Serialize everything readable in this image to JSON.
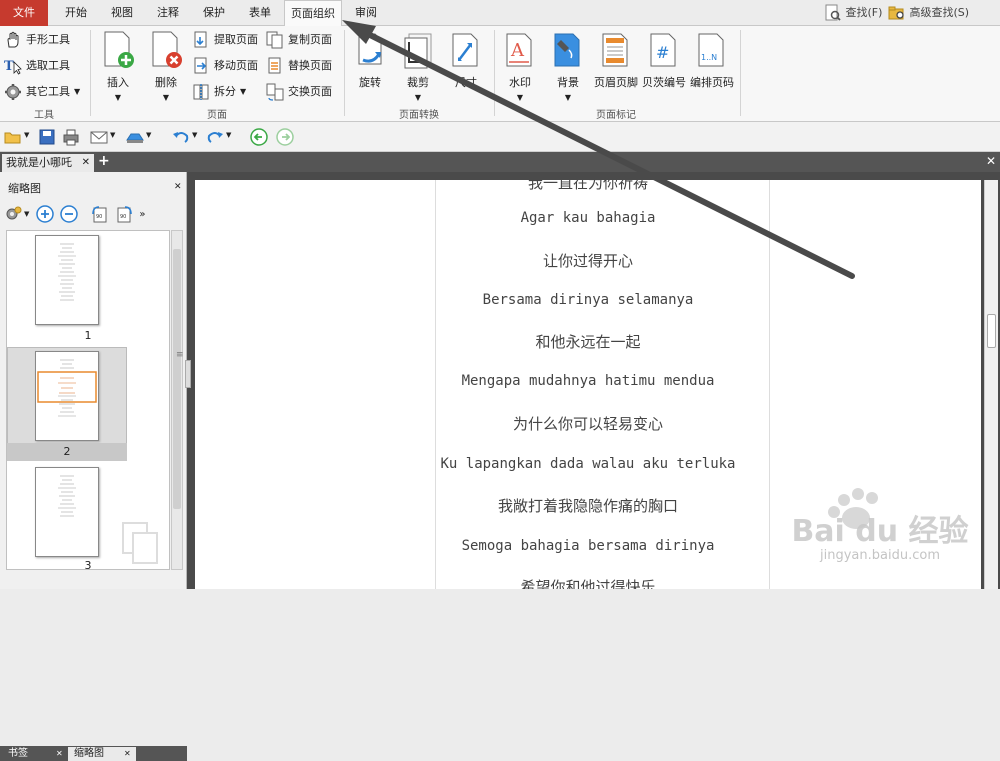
{
  "menubar": {
    "file": "文件",
    "tabs": [
      "开始",
      "视图",
      "注释",
      "保护",
      "表单",
      "页面组织",
      "审阅"
    ],
    "active_tab": "页面组织",
    "find": "查找(F)",
    "advanced_find": "高级查找(S)"
  },
  "ribbon": {
    "tools": {
      "hand": "手形工具",
      "select": "选取工具",
      "other": "其它工具",
      "label": "工具"
    },
    "page_group": {
      "insert": "插入",
      "delete": "删除",
      "extract": "提取页面",
      "move": "移动页面",
      "split": "拆分",
      "copy": "复制页面",
      "replace": "替换页面",
      "swap": "交换页面",
      "label": "页面"
    },
    "transform_group": {
      "rotate": "旋转",
      "crop": "裁剪",
      "size": "尺寸",
      "label": "页面转换"
    },
    "mark_group": {
      "watermark": "水印",
      "background": "背景",
      "header_footer": "页眉页脚",
      "bates": "贝茨编号",
      "page_number": "编排页码",
      "label": "页面标记"
    }
  },
  "doc_tab": {
    "title": "我就是小哪吒"
  },
  "left_panel": {
    "title": "缩略图",
    "thumbs": [
      "1",
      "2",
      "3"
    ],
    "bottom_tabs": [
      "书签",
      "缩略图"
    ]
  },
  "document": {
    "lines": [
      "我一直在为你祈祷",
      "Agar kau bahagia",
      "让你过得开心",
      "Bersama dirinya selamanya",
      "和他永远在一起",
      "Mengapa mudahnya hatimu mendua",
      "为什么你可以轻易变心",
      "Ku lapangkan dada walau aku terluka",
      "我敞打着我隐隐作痛的胸口",
      "Semoga bahagia bersama dirinya",
      "希望你和他过得快乐"
    ]
  },
  "watermark": {
    "brand": "Bai du 经验",
    "url": "jingyan.baidu.com"
  },
  "colors": {
    "file_tab": "#c63a2e",
    "accent_blue": "#2b7fd1",
    "accent_orange": "#e88a2e"
  }
}
